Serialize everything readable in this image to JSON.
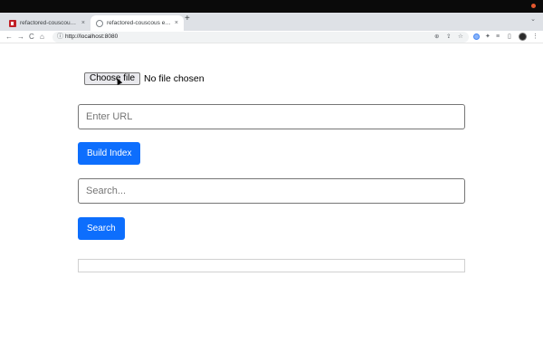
{
  "browser": {
    "tabs": [
      {
        "title": "refactored-couscous - npm",
        "close": "×",
        "favicon": "npm-favicon-icon"
      },
      {
        "title": "refactored-couscous example",
        "close": "×",
        "favicon": "globe-favicon-icon"
      }
    ],
    "new_tab": "+",
    "tab_menu": "⌄",
    "nav": {
      "back": "←",
      "forward": "→",
      "reload": "C",
      "home": "⌂"
    },
    "address": "http://localhost:8080",
    "address_icons": {
      "info": "ⓘ",
      "zoom": "⊕",
      "share": "⇪",
      "bookmark": "☆"
    },
    "extensions": {
      "puzzle": "✦",
      "media": "≡",
      "sidebar": "▯",
      "menu": "⋮"
    }
  },
  "page": {
    "file_button": "Choose file",
    "file_status": "No file chosen",
    "url_placeholder": "Enter URL",
    "build_button": "Build Index",
    "search_placeholder": "Search...",
    "search_button": "Search",
    "results": ""
  },
  "colors": {
    "primary_button": "#0d6efd",
    "tab_strip": "#dee1e6",
    "omnibox": "#f1f3f4"
  }
}
